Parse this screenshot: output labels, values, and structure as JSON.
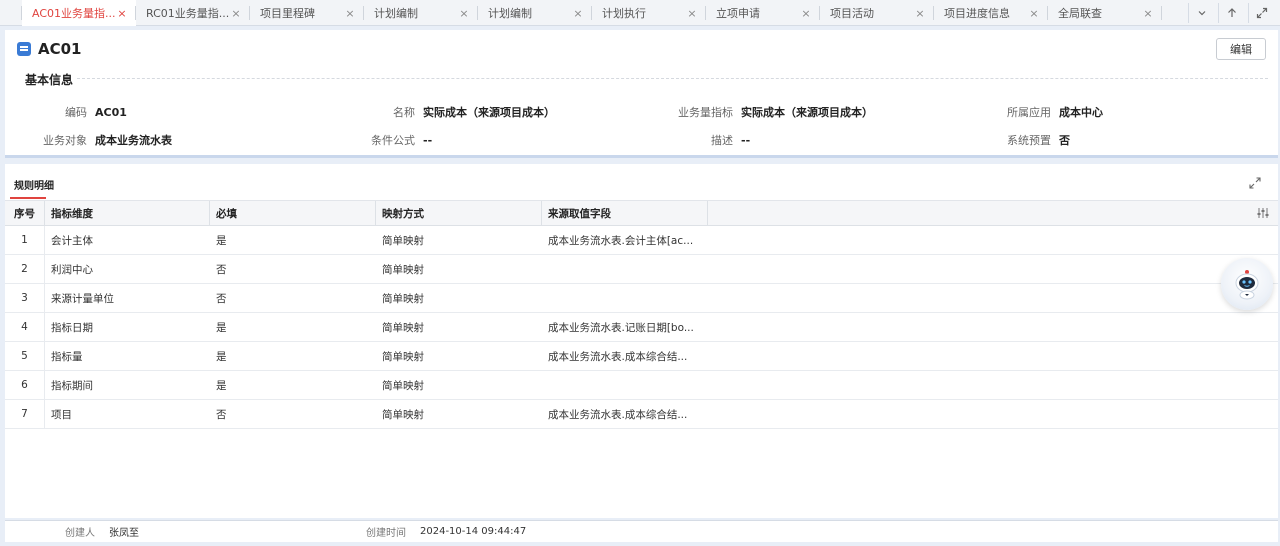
{
  "tabs": [
    {
      "label": "AC01业务量指...",
      "active": true
    },
    {
      "label": "RC01业务量指...",
      "active": false
    },
    {
      "label": "项目里程碑",
      "active": false
    },
    {
      "label": "计划编制",
      "active": false
    },
    {
      "label": "计划编制",
      "active": false
    },
    {
      "label": "计划执行",
      "active": false
    },
    {
      "label": "立项申请",
      "active": false
    },
    {
      "label": "项目活动",
      "active": false
    },
    {
      "label": "项目进度信息",
      "active": false
    },
    {
      "label": "全局联查",
      "active": false
    }
  ],
  "tab_close_glyph": "×",
  "header": {
    "title": "AC01",
    "edit_label": "编辑"
  },
  "basic_info": {
    "section_title": "基本信息",
    "fields": [
      {
        "label": "编码",
        "value": "AC01"
      },
      {
        "label": "名称",
        "value": "实际成本（来源项目成本）"
      },
      {
        "label": "业务量指标",
        "value": "实际成本（来源项目成本）"
      },
      {
        "label": "所属应用",
        "value": "成本中心"
      },
      {
        "label": "业务对象",
        "value": "成本业务流水表"
      },
      {
        "label": "条件公式",
        "value": "--"
      },
      {
        "label": "描述",
        "value": "--"
      },
      {
        "label": "系统预置",
        "value": "否"
      }
    ]
  },
  "rules": {
    "tab_label": "规则明细",
    "columns": [
      "序号",
      "指标维度",
      "必填",
      "映射方式",
      "来源取值字段"
    ],
    "rows": [
      {
        "idx": "1",
        "dimension": "会计主体",
        "required": "是",
        "mapping": "简单映射",
        "source": "成本业务流水表.会计主体[ac..."
      },
      {
        "idx": "2",
        "dimension": "利润中心",
        "required": "否",
        "mapping": "简单映射",
        "source": ""
      },
      {
        "idx": "3",
        "dimension": "来源计量单位",
        "required": "否",
        "mapping": "简单映射",
        "source": ""
      },
      {
        "idx": "4",
        "dimension": "指标日期",
        "required": "是",
        "mapping": "简单映射",
        "source": "成本业务流水表.记账日期[bo..."
      },
      {
        "idx": "5",
        "dimension": "指标量",
        "required": "是",
        "mapping": "简单映射",
        "source": "成本业务流水表.成本综合结..."
      },
      {
        "idx": "6",
        "dimension": "指标期间",
        "required": "是",
        "mapping": "简单映射",
        "source": ""
      },
      {
        "idx": "7",
        "dimension": "项目",
        "required": "否",
        "mapping": "简单映射",
        "source": "成本业务流水表.成本综合结..."
      }
    ]
  },
  "footer": {
    "creator_label": "创建人",
    "creator": "张凤至",
    "created_label": "创建时间",
    "created": "2024-10-14 09:44:47"
  },
  "colors": {
    "accent": "#e0443f",
    "brand_blue": "#3a7bd5"
  },
  "icons": [
    "chevron-down-icon",
    "upload-icon",
    "expand-icon",
    "fullscreen-icon",
    "column-settings-icon",
    "robot-assistant-icon",
    "form-icon"
  ]
}
